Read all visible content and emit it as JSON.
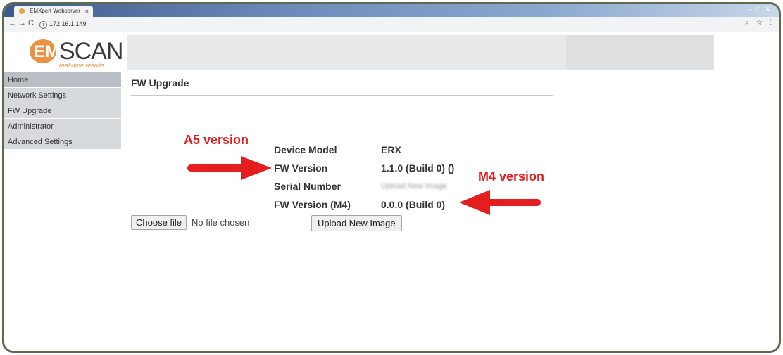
{
  "browser": {
    "tab_title": "EMXpert Webserver",
    "tab_close": "×",
    "url": "172.16.1.149",
    "url_info": "i",
    "back": "←",
    "forward": "→",
    "reload": "C",
    "window_controls": "– □ ✕",
    "addr_icons": "⌕ ☆ ⋮"
  },
  "logo": {
    "em": "EM",
    "scan": "SCAN",
    "tagline": "real-time results"
  },
  "sidebar": {
    "items": [
      {
        "label": "Home"
      },
      {
        "label": "Network Settings"
      },
      {
        "label": "FW Upgrade"
      },
      {
        "label": "Administrator"
      },
      {
        "label": "Advanced Settings"
      }
    ]
  },
  "main": {
    "title": "FW Upgrade",
    "fields": [
      {
        "label": "Device Model",
        "value": "ERX"
      },
      {
        "label": "FW Version",
        "value": "1.1.0 (Build 0) ()"
      },
      {
        "label": "Serial Number",
        "value": "Upload New Image"
      },
      {
        "label": "FW Version (M4)",
        "value": "0.0.0 (Build 0)"
      }
    ],
    "choose_file_label": "Choose file",
    "no_file_text": "No file chosen",
    "upload_label": "Upload New Image"
  },
  "annotations": {
    "a5": "A5 version",
    "m4": "M4 version",
    "color": "#e41e1e"
  }
}
